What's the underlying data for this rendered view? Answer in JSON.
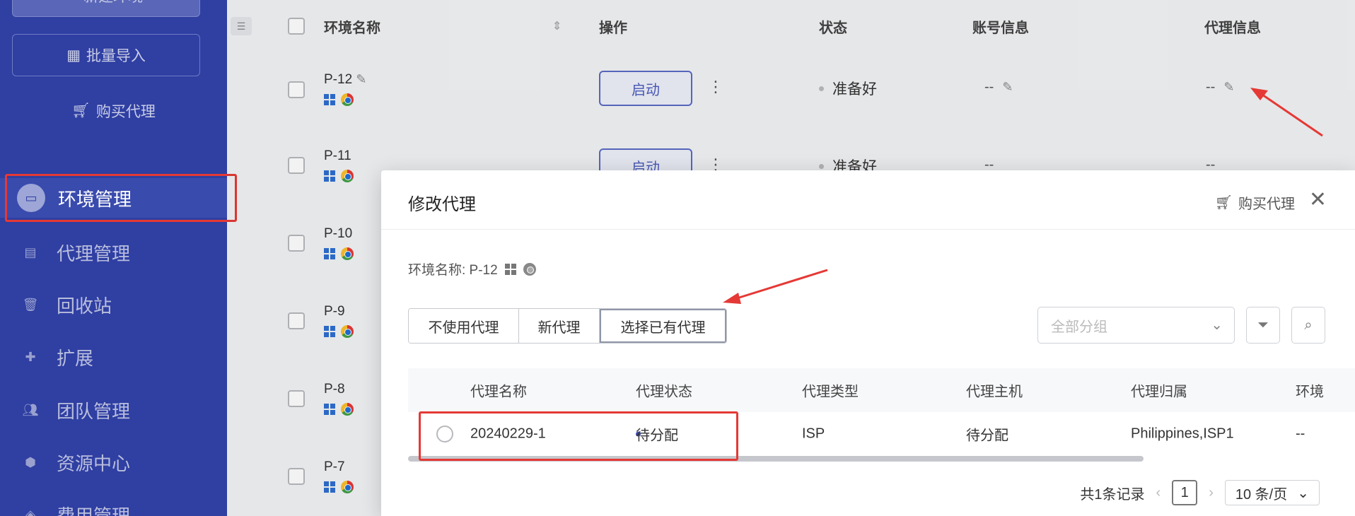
{
  "sidebar": {
    "new_env_label": "新建环境",
    "import_label": "批量导入",
    "buy_proxy_label": "购买代理",
    "nav": [
      {
        "label": "环境管理",
        "icon": "monitor-icon"
      },
      {
        "label": "代理管理",
        "icon": "server-icon"
      },
      {
        "label": "回收站",
        "icon": "trash-icon"
      },
      {
        "label": "扩展",
        "icon": "puzzle-icon"
      },
      {
        "label": "团队管理",
        "icon": "team-icon"
      },
      {
        "label": "资源中心",
        "icon": "box-icon"
      },
      {
        "label": "费用管理",
        "icon": "wallet-icon"
      }
    ]
  },
  "table": {
    "headers": {
      "name": "环境名称",
      "ops": "操作",
      "status": "状态",
      "account": "账号信息",
      "proxy": "代理信息"
    },
    "start_label": "启动",
    "rows": [
      {
        "name": "P-12",
        "status": "准备好",
        "account": "--",
        "proxy": "--"
      },
      {
        "name": "P-11",
        "status": "准备好",
        "account": "--",
        "proxy": "--"
      },
      {
        "name": "P-10"
      },
      {
        "name": "P-9"
      },
      {
        "name": "P-8"
      },
      {
        "name": "P-7"
      }
    ]
  },
  "modal": {
    "title": "修改代理",
    "buy_link": "购买代理",
    "env_label": "环境名称: P-12",
    "tabs": [
      "不使用代理",
      "新代理",
      "选择已有代理"
    ],
    "group_placeholder": "全部分组",
    "columns": [
      "代理名称",
      "代理状态",
      "代理类型",
      "代理主机",
      "代理归属",
      "环境"
    ],
    "rows": [
      {
        "name": "20240229-1",
        "status": "待分配",
        "type": "ISP",
        "host": "待分配",
        "owner": "Philippines,ISP1",
        "env": "--"
      }
    ],
    "pager": {
      "total": "共1条记录",
      "page": "1",
      "size": "10 条/页"
    }
  },
  "colors": {
    "sidebar": "#2f3fa2",
    "accent": "#4a5bbd",
    "annotation": "#e53935"
  }
}
